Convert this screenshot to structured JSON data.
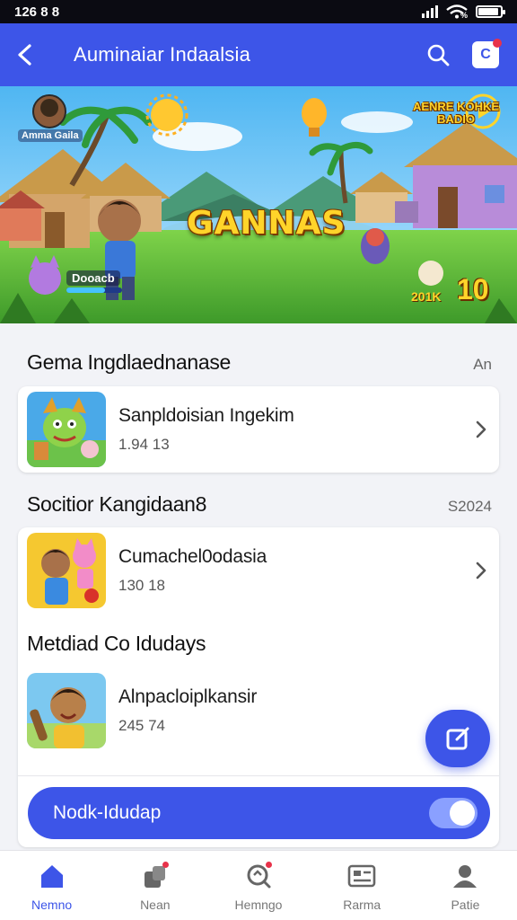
{
  "status_bar": {
    "time": "126 8 8",
    "battery_level": 0.9
  },
  "app_bar": {
    "title": "Auminaiar Indaalsia",
    "back_icon": "back-arrow-icon",
    "search_icon": "search-icon",
    "notification_icon": "notification-icon",
    "notification_letter": "C"
  },
  "banner": {
    "title": "GANNAS",
    "top_left_label": "Amma Gaila",
    "top_right_badge": "AENRE KOHKE BADIO",
    "player_label": "Dooacb",
    "player_progress": 0.7,
    "score_small": "201K",
    "score": "10"
  },
  "sections": [
    {
      "title": "Gema Ingdlaednanase",
      "meta": "An"
    },
    {
      "title": "Socitior Kangidaan8",
      "meta": "S2024"
    },
    {
      "title": "Metdiad Co Idudays",
      "meta": ""
    }
  ],
  "items": [
    {
      "title": "Sanpldoisian  Ingekim",
      "subtitle": "1.94 13",
      "thumb": "dragon-character-thumbnail",
      "chevron": "chevron-right-icon"
    },
    {
      "title": "Cumachel0odasia",
      "subtitle": "130 18",
      "thumb": "kids-with-cat-thumbnail",
      "chevron": "chevron-right-icon"
    },
    {
      "title": "Alnpacloiplkansir",
      "subtitle": "245 74",
      "thumb": "boy-with-bat-thumbnail",
      "chevron": ""
    }
  ],
  "fab": {
    "icon": "edit-icon"
  },
  "toggle": {
    "label": "Nodk-Idudap",
    "on": true
  },
  "bottom_nav": [
    {
      "label": "Nemno",
      "icon": "home-icon",
      "active": true
    },
    {
      "label": "Nean",
      "icon": "games-icon",
      "active": false
    },
    {
      "label": "Hemngo",
      "icon": "search-badge-icon",
      "active": false
    },
    {
      "label": "Rarma",
      "icon": "card-icon",
      "active": false
    },
    {
      "label": "Patie",
      "icon": "profile-icon",
      "active": false
    }
  ],
  "colors": {
    "accent": "#3d55e8",
    "badge": "#e8324a",
    "title_gold": "#ffd42a"
  }
}
